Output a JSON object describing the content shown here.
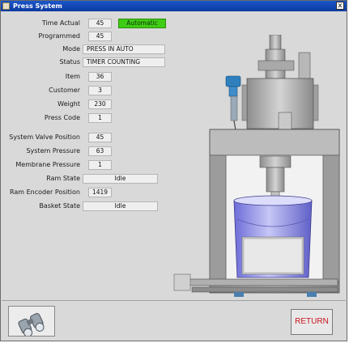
{
  "window": {
    "title": "Press System",
    "close_glyph": "x"
  },
  "fields": {
    "time_actual": {
      "label": "Time Actual",
      "value": "45"
    },
    "mode_indicator": {
      "value": "Automatic",
      "color": "#3fcc14"
    },
    "programmed": {
      "label": "Programmed",
      "value": "45"
    },
    "mode": {
      "label": "Mode",
      "value": "PRESS IN AUTO"
    },
    "status": {
      "label": "Status",
      "value": "TIMER COUNTING"
    },
    "item": {
      "label": "Item",
      "value": "36"
    },
    "customer": {
      "label": "Customer",
      "value": "3"
    },
    "weight": {
      "label": "Weight",
      "value": "230"
    },
    "press_code": {
      "label": "Press Code",
      "value": "1"
    },
    "system_valve": {
      "label": "System Valve Position",
      "value": "45"
    },
    "system_pressure": {
      "label": "System Pressure",
      "value": "63"
    },
    "membrane_pressure": {
      "label": "Membrane Pressure",
      "value": "1"
    },
    "ram_state": {
      "label": "Ram State",
      "value": "Idle"
    },
    "ram_encoder": {
      "label": "Ram Encoder Position",
      "value": "1419"
    },
    "basket_state": {
      "label": "Basket State",
      "value": "Idle"
    }
  },
  "buttons": {
    "return_label": "RETURN",
    "return_color": "#c8141e",
    "binoculars_icon": "binoculars-icon"
  }
}
